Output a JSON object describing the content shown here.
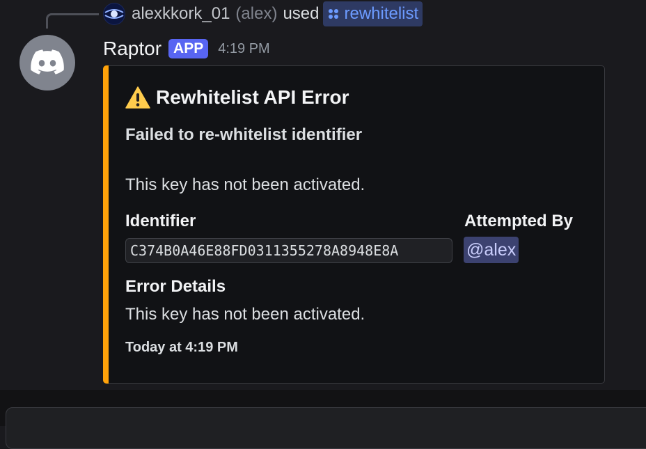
{
  "reply": {
    "username": "alexkkork_01",
    "nickname": "(alex)",
    "used_text": "used",
    "command": "rewhitelist"
  },
  "message": {
    "author": "Raptor",
    "badge": "APP",
    "timestamp": "4:19 PM"
  },
  "embed": {
    "accent_color": "#ffa20a",
    "title_icon": "warning-icon",
    "title": "Rewhitelist API Error",
    "subtitle": "Failed to re-whitelist identifier",
    "description": "This key has not been activated.",
    "fields": [
      {
        "name": "Identifier",
        "value": "C374B0A46E88FD0311355278A8948E8A"
      },
      {
        "name": "Attempted By",
        "value": "@alex"
      },
      {
        "name": "Error Details",
        "value": "This key has not been activated."
      }
    ],
    "footer": "Today at 4:19 PM"
  },
  "colors": {
    "background": "#1a1a1e",
    "app_badge": "#5865f2",
    "mention_bg": "#3c4270",
    "command_chip_bg": "#2e3a63"
  }
}
